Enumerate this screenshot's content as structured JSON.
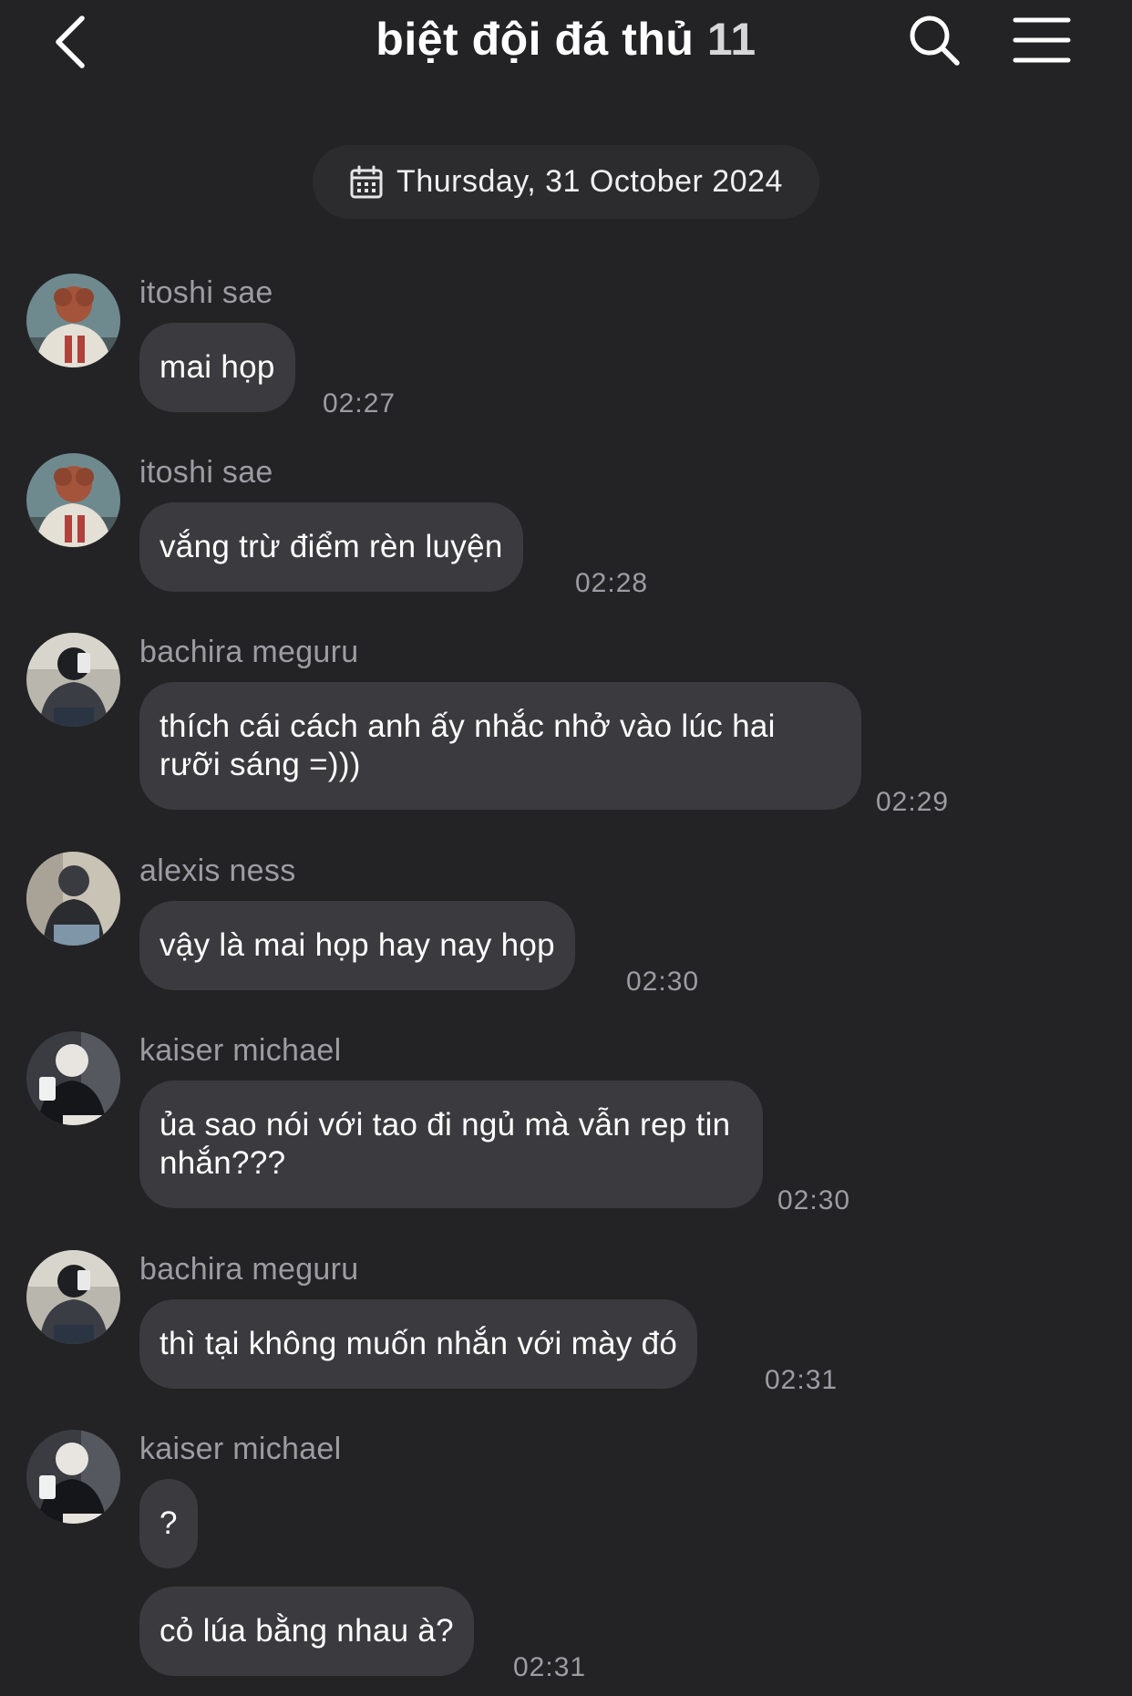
{
  "header": {
    "title": "biệt đội đá thủ",
    "member_count": "11"
  },
  "date_divider": "Thursday, 31 October 2024",
  "messages": [
    {
      "sender": "itoshi sae",
      "text": "mai họp",
      "time": "02:27"
    },
    {
      "sender": "itoshi sae",
      "text": "vắng trừ điểm rèn luyện",
      "time": "02:28"
    },
    {
      "sender": "bachira meguru",
      "text": "thích cái cách anh ấy nhắc nhở vào lúc hai rưỡi sáng =)))",
      "time": "02:29"
    },
    {
      "sender": "alexis ness",
      "text": "vậy là mai họp hay nay họp",
      "time": "02:30"
    },
    {
      "sender": "kaiser michael",
      "text": "ủa sao nói với tao đi ngủ mà vẫn rep tin nhắn???",
      "time": "02:30"
    },
    {
      "sender": "bachira meguru",
      "text": "thì tại không muốn nhắn với mày đó",
      "time": "02:31"
    },
    {
      "sender": "kaiser michael",
      "text": "?",
      "time": ""
    },
    {
      "sender": "",
      "text": "cỏ lúa bằng nhau à?",
      "time": "02:31"
    }
  ],
  "colors": {
    "background": "#232325",
    "bubble": "#3b3b3f",
    "date_pill": "#2c2c2f",
    "secondary_text": "#9c9ca3"
  },
  "icons": {
    "back": "chevron-left-icon",
    "search": "search-icon",
    "menu": "hamburger-menu-icon",
    "calendar": "calendar-icon"
  }
}
